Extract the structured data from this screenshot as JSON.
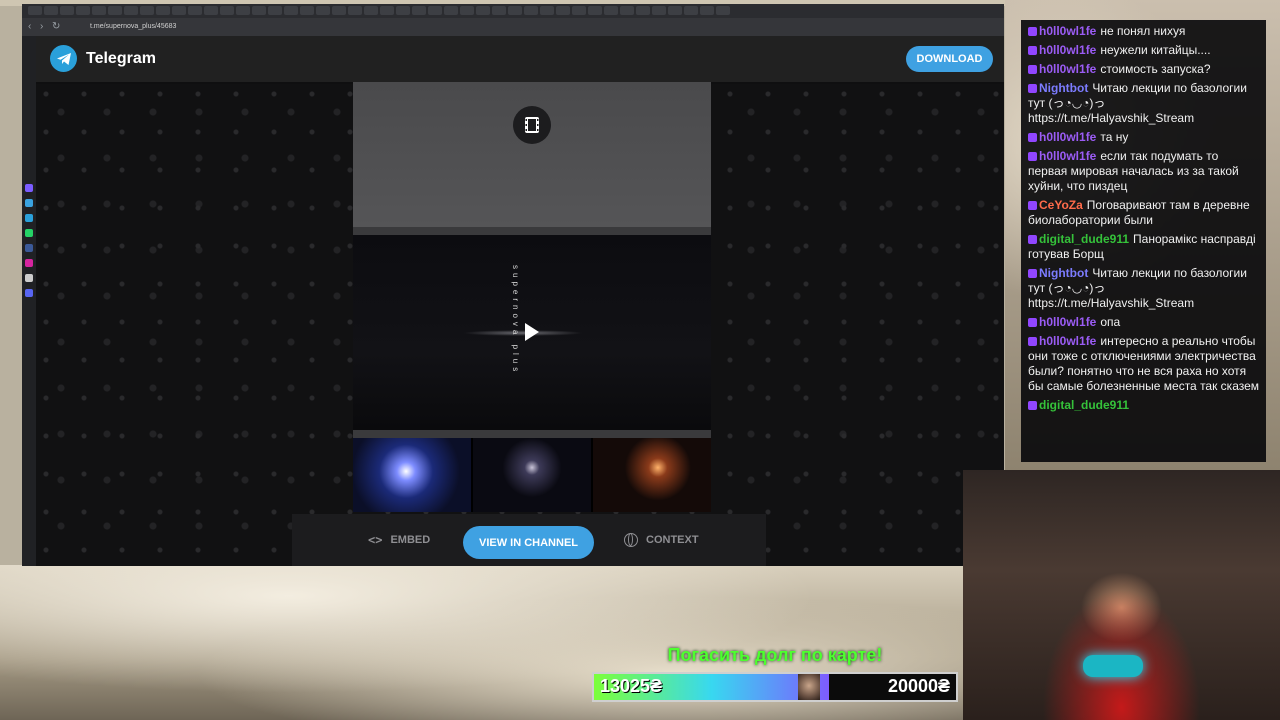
{
  "browser": {
    "url": "t.me/supernova_plus/45683"
  },
  "header": {
    "title": "Telegram",
    "download_label": "DOWNLOAD"
  },
  "post": {
    "watermark": "supernova plus"
  },
  "actions": {
    "embed_label": "EMBED",
    "view_label": "VIEW IN CHANNEL",
    "context_label": "CONTEXT"
  },
  "chat": {
    "messages": [
      {
        "user": "h0ll0wl1fe",
        "color": "#9b5cf5",
        "text": "не понял нихуя"
      },
      {
        "user": "h0ll0wl1fe",
        "color": "#9b5cf5",
        "text": "неужели китайцы...."
      },
      {
        "user": "h0ll0wl1fe",
        "color": "#9b5cf5",
        "text": "стоимость запуска?"
      },
      {
        "user": "Nightbot",
        "color": "#7c7cff",
        "text": "Читаю лекции по базологии тут (っ◔◡◔)っ https://t.me/Halyavshik_Stream"
      },
      {
        "user": "h0ll0wl1fe",
        "color": "#9b5cf5",
        "text": "та ну"
      },
      {
        "user": "h0ll0wl1fe",
        "color": "#9b5cf5",
        "text": "если так подумать то первая мировая началась из за такой хуйни, что пиздец"
      },
      {
        "user": "CeYoZa",
        "color": "#ff6b4a",
        "text": "Поговаривают там в деревне биолаборатории были"
      },
      {
        "user": "digital_dude911",
        "color": "#35c23a",
        "text": "Панорамікс насправді готував Борщ"
      },
      {
        "user": "Nightbot",
        "color": "#7c7cff",
        "text": "Читаю лекции по базологии тут (っ◔◡◔)っ https://t.me/Halyavshik_Stream"
      },
      {
        "user": "h0ll0wl1fe",
        "color": "#9b5cf5",
        "text": "опа"
      },
      {
        "user": "h0ll0wl1fe",
        "color": "#9b5cf5",
        "text": "интересно а реально чтобы они тоже с отключениями электричества были? понятно что не вся раха но хотя бы самые болезненные места так сказем"
      },
      {
        "user": "digital_dude911",
        "color": "#35c23a",
        "text": ""
      }
    ]
  },
  "donation": {
    "title": "Погасить долг по карте!",
    "current": "13025₴",
    "goal": "20000₴",
    "progress": 0.65
  },
  "colors": {
    "accent": "#3fa1e2",
    "donate_title": "#4dff2f"
  }
}
